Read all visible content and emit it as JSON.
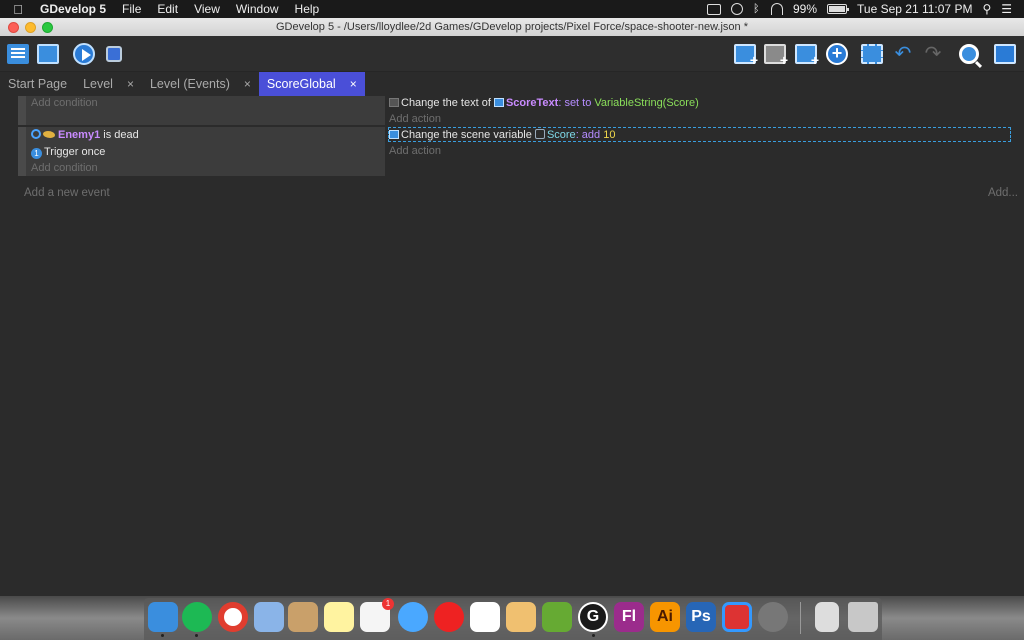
{
  "menubar": {
    "app_name": "GDevelop 5",
    "items": [
      "File",
      "Edit",
      "View",
      "Window",
      "Help"
    ],
    "battery": "99%",
    "datetime": "Tue Sep 21  11:07 PM"
  },
  "window": {
    "title": "GDevelop 5 - /Users/lloydlee/2d Games/GDevelop projects/Pixel Force/space-shooter-new.json *"
  },
  "tabs": [
    {
      "label": "Start Page",
      "closable": false
    },
    {
      "label": "Level",
      "closable": true
    },
    {
      "label": "Level (Events)",
      "closable": true
    },
    {
      "label": "ScoreGlobal",
      "closable": true,
      "active": true
    }
  ],
  "tab_close": "×",
  "events": [
    {
      "conditions_add": "Add condition",
      "action1": {
        "prefix": "Change the text of ",
        "object": "ScoreText",
        "op": ": set to ",
        "value": "VariableString(Score)"
      },
      "actions_add": "Add action"
    },
    {
      "condition1": {
        "object": "Enemy1",
        "suffix": " is dead"
      },
      "condition2": {
        "number": "1",
        "text": "Trigger once"
      },
      "conditions_add": "Add condition",
      "action1": {
        "prefix": "Change the scene variable ",
        "variable": "Score",
        "op": ": add ",
        "value": "10"
      },
      "actions_add": "Add action"
    }
  ],
  "add_event": "Add a new event",
  "add_more": "Add...",
  "dock": {
    "apps": [
      "finder",
      "spotify",
      "chrome",
      "preview",
      "contacts",
      "notes",
      "reminders",
      "messages",
      "youtube-music",
      "numbers",
      "textedit",
      "instastats",
      "gdevelop",
      "fireworks",
      "illustrator",
      "photoshop",
      "parallels",
      "system-preferences",
      "document",
      "trash"
    ],
    "labels": {
      "fireworks": "Fl",
      "illustrator": "Ai",
      "photoshop": "Ps",
      "gdevelop": "G"
    },
    "reminders_badge": "1",
    "colors": {
      "finder": "#3a8ede",
      "spotify": "#1db954",
      "chrome": "#ffffff",
      "fireworks": "#9b2c8c",
      "illustrator": "#f79500",
      "photoshop": "#2766b6",
      "gdevelop": "#ffffff"
    }
  }
}
